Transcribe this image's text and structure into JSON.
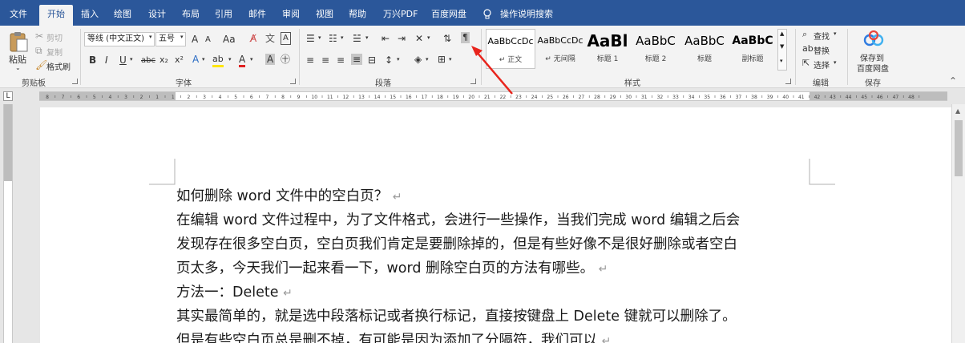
{
  "tabs": [
    {
      "label": "文件",
      "active": false
    },
    {
      "label": "开始",
      "active": true
    },
    {
      "label": "插入",
      "active": false
    },
    {
      "label": "绘图",
      "active": false
    },
    {
      "label": "设计",
      "active": false
    },
    {
      "label": "布局",
      "active": false
    },
    {
      "label": "引用",
      "active": false
    },
    {
      "label": "邮件",
      "active": false
    },
    {
      "label": "审阅",
      "active": false
    },
    {
      "label": "视图",
      "active": false
    },
    {
      "label": "帮助",
      "active": false
    },
    {
      "label": "万兴PDF",
      "active": false
    },
    {
      "label": "百度网盘",
      "active": false
    }
  ],
  "tell_me": "操作说明搜索",
  "clipboard": {
    "paste": "粘贴",
    "cut": "剪切",
    "copy": "复制",
    "format_painter": "格式刷",
    "group": "剪贴板"
  },
  "font": {
    "font_name": "等线 (中文正文)",
    "font_size": "五号",
    "grow": "A",
    "shrink": "A",
    "case": "Aa",
    "wen": "文",
    "bold": "B",
    "italic": "I",
    "underline": "U",
    "strike": "abc",
    "sub": "x₂",
    "sup": "x²",
    "font_color": "A",
    "highlight": "ab",
    "group": "字体"
  },
  "paragraph": {
    "group": "段落"
  },
  "styles": {
    "items": [
      {
        "preview": "AaBbCcDc",
        "name": "↵ 正文",
        "selected": true
      },
      {
        "preview": "AaBbCcDc",
        "name": "↵ 无间隔",
        "selected": false
      },
      {
        "preview": "AaBl",
        "name": "标题 1",
        "selected": false
      },
      {
        "preview": "AaBbC",
        "name": "标题 2",
        "selected": false
      },
      {
        "preview": "AaBbC",
        "name": "标题",
        "selected": false
      },
      {
        "preview": "AaBbC",
        "name": "副标题",
        "selected": false
      }
    ],
    "group": "样式"
  },
  "editing": {
    "find": "查找",
    "replace": "替换",
    "select": "选择",
    "group": "编辑"
  },
  "save": {
    "label1": "保存到",
    "label2": "百度网盘",
    "group": "保存"
  },
  "ruler_numbers": [
    "8",
    "7",
    "6",
    "5",
    "4",
    "3",
    "2",
    "1",
    "1",
    "2",
    "3",
    "4",
    "5",
    "6",
    "7",
    "8",
    "9",
    "10",
    "11",
    "12",
    "13",
    "14",
    "15",
    "16",
    "17",
    "18",
    "19",
    "20",
    "21",
    "22",
    "23",
    "24",
    "25",
    "26",
    "27",
    "28",
    "29",
    "30",
    "31",
    "32",
    "33",
    "34",
    "35",
    "36",
    "37",
    "38",
    "39",
    "40",
    "41",
    "42",
    "43",
    "44",
    "45",
    "46",
    "47",
    "48"
  ],
  "document": {
    "lines": [
      {
        "text": "如何删除 word 文件中的空白页？",
        "mark": "↵"
      },
      {
        "text": "在编辑 word 文件过程中，为了文件格式，会进行一些操作，当我们完成 word 编辑之后会",
        "mark": ""
      },
      {
        "text": "发现存在很多空白页，空白页我们肯定是要删除掉的，但是有些好像不是很好删除或者空白",
        "mark": ""
      },
      {
        "text": "页太多，今天我们一起来看一下，word 删除空白页的方法有哪些。",
        "mark": "↵"
      },
      {
        "text": "方法一：Delete",
        "mark": "↵"
      },
      {
        "text": "其实最简单的，就是选中段落标记或者换行标记，直接按键盘上 Delete 键就可以删除了。",
        "mark": ""
      },
      {
        "text": "但是有些空白页总是删不掉，有可能是因为添加了分隔符，我们可以",
        "mark": "↵"
      }
    ]
  },
  "colors": {
    "title_bar": "#2b579a",
    "ribbon": "#f3f3f3",
    "annotation_arrow": "#e8241c"
  }
}
